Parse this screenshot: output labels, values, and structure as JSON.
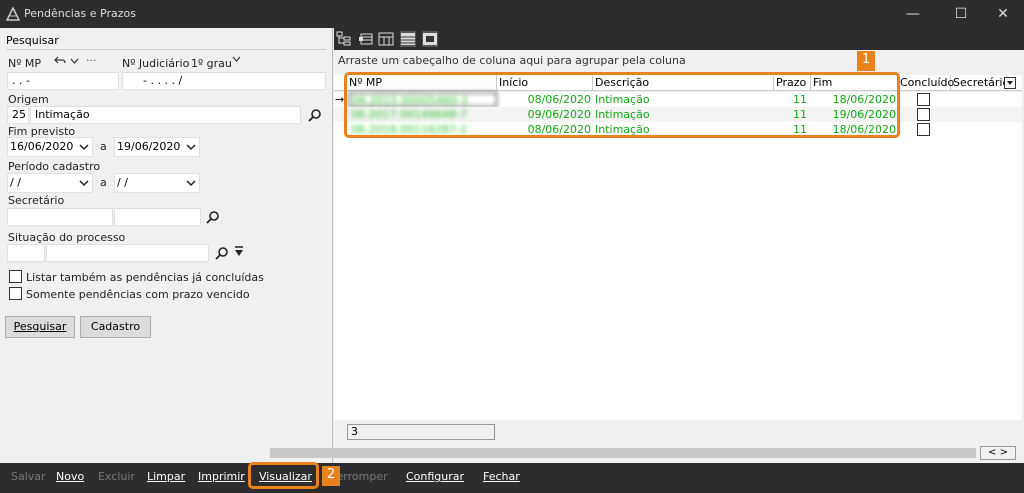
{
  "window": {
    "title": "Pendências e Prazos"
  },
  "left": {
    "section_title": "Pesquisar",
    "nmp_label": "Nº MP",
    "nmp_value": ". .      -",
    "njud_label": "Nº Judiciário",
    "grau_label": "1º grau",
    "njud_value": "-  .  . . .  /",
    "origem_label": "Origem",
    "origem_code": "25",
    "origem_value": "Intimação",
    "fim_label": "Fim previsto",
    "fim_from": "16/06/2020",
    "fim_to": "19/06/2020",
    "periodo_label": "Período cadastro",
    "periodo_from": " / /",
    "periodo_to": " / /",
    "a_label": "a",
    "secretario_label": "Secretário",
    "situacao_label": "Situação do processo",
    "chk1": "Listar também as pendências já concluídas",
    "chk2": "Somente pendências com prazo vencido",
    "btn_pesquisar": "Pesquisar",
    "btn_cadastro": "Cadastro"
  },
  "grid": {
    "group_hint": "Arraste um cabeçalho de coluna aqui para agrupar pela coluna",
    "columns": [
      "Nº MP",
      "Início",
      "Descrição",
      "Prazo",
      "Fim",
      "Concluído",
      "Secretário"
    ],
    "rows": [
      {
        "nmp": "06.2015.00005460-3",
        "inicio": "08/06/2020",
        "descricao": "Intimação",
        "prazo": "11",
        "fim": "18/06/2020"
      },
      {
        "nmp": "06.2017.00149648-7",
        "inicio": "09/06/2020",
        "descricao": "Intimação",
        "prazo": "11",
        "fim": "19/06/2020"
      },
      {
        "nmp": "06.2018.00116287-2",
        "inicio": "08/06/2020",
        "descricao": "Intimação",
        "prazo": "11",
        "fim": "18/06/2020"
      }
    ],
    "count": "3"
  },
  "bottom": {
    "salvar": "Salvar",
    "novo": "Novo",
    "excluir": "Excluir",
    "limpar": "Limpar",
    "imprimir": "Imprimir",
    "visualizar": "Visualizar",
    "interromper": "Interromper",
    "configurar": "Configurar",
    "fechar": "Fechar"
  },
  "callouts": {
    "one": "1",
    "two": "2"
  },
  "colors": {
    "accent": "#e8821e",
    "row_text": "#16a516"
  }
}
